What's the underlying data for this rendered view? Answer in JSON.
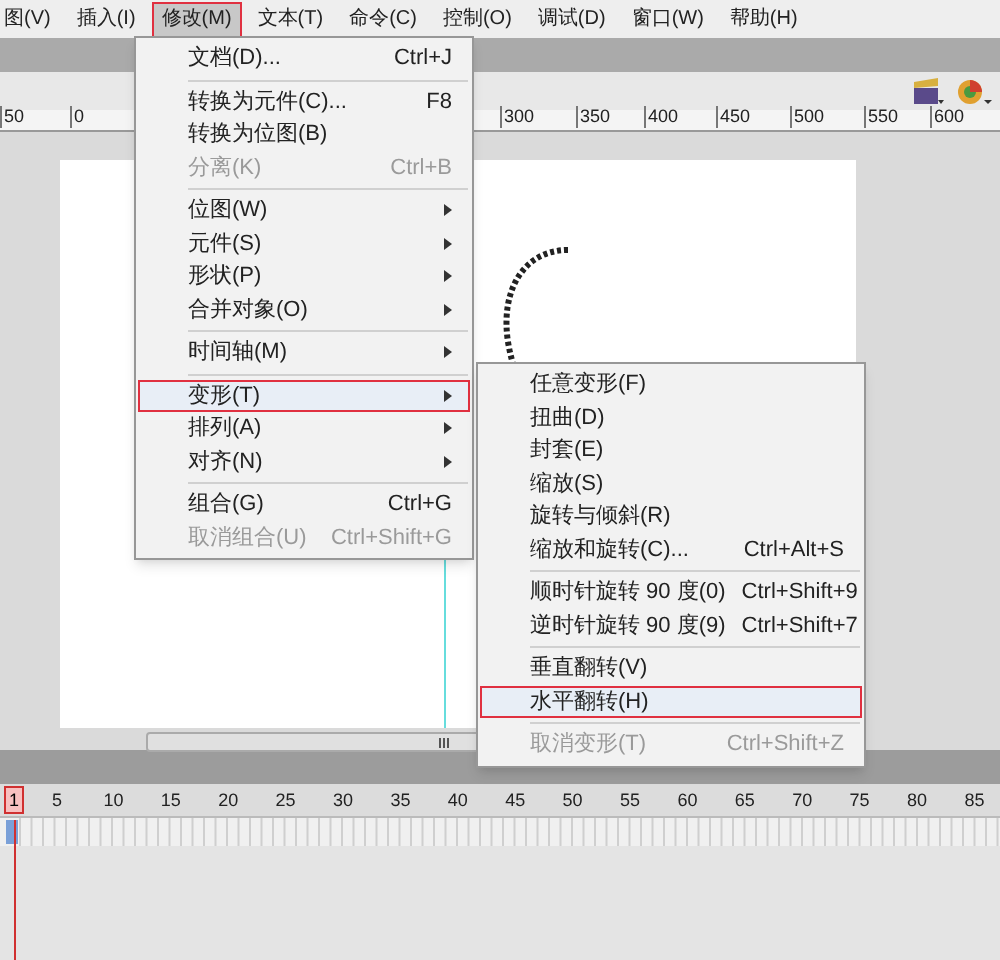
{
  "menu_bar": [
    {
      "label": "图(V)",
      "selected": false
    },
    {
      "label": "插入(I)",
      "selected": false
    },
    {
      "label": "修改(M)",
      "selected": true
    },
    {
      "label": "文本(T)",
      "selected": false
    },
    {
      "label": "命令(C)",
      "selected": false
    },
    {
      "label": "控制(O)",
      "selected": false
    },
    {
      "label": "调试(D)",
      "selected": false
    },
    {
      "label": "窗口(W)",
      "selected": false
    },
    {
      "label": "帮助(H)",
      "selected": false
    }
  ],
  "ruler": {
    "left_labels": [
      "50",
      "0"
    ],
    "right_labels": [
      "300",
      "350",
      "400",
      "450",
      "500",
      "550",
      "600"
    ]
  },
  "modify_menu": [
    {
      "kind": "item",
      "label": "文档(D)...",
      "shortcut": "Ctrl+J",
      "submenu": false,
      "disabled": false,
      "selected": false
    },
    {
      "kind": "separator"
    },
    {
      "kind": "item",
      "label": "转换为元件(C)...",
      "shortcut": "F8",
      "submenu": false,
      "disabled": false,
      "selected": false
    },
    {
      "kind": "item",
      "label": "转换为位图(B)",
      "submenu": false,
      "disabled": false,
      "selected": false
    },
    {
      "kind": "item",
      "label": "分离(K)",
      "shortcut": "Ctrl+B",
      "submenu": false,
      "disabled": true,
      "selected": false
    },
    {
      "kind": "separator"
    },
    {
      "kind": "item",
      "label": "位图(W)",
      "submenu": true,
      "disabled": false,
      "selected": false
    },
    {
      "kind": "item",
      "label": "元件(S)",
      "submenu": true,
      "disabled": false,
      "selected": false
    },
    {
      "kind": "item",
      "label": "形状(P)",
      "submenu": true,
      "disabled": false,
      "selected": false
    },
    {
      "kind": "item",
      "label": "合并对象(O)",
      "submenu": true,
      "disabled": false,
      "selected": false
    },
    {
      "kind": "separator"
    },
    {
      "kind": "item",
      "label": "时间轴(M)",
      "submenu": true,
      "disabled": false,
      "selected": false
    },
    {
      "kind": "separator"
    },
    {
      "kind": "item",
      "label": "变形(T)",
      "submenu": true,
      "disabled": false,
      "selected": true
    },
    {
      "kind": "item",
      "label": "排列(A)",
      "submenu": true,
      "disabled": false,
      "selected": false
    },
    {
      "kind": "item",
      "label": "对齐(N)",
      "submenu": true,
      "disabled": false,
      "selected": false
    },
    {
      "kind": "separator"
    },
    {
      "kind": "item",
      "label": "组合(G)",
      "shortcut": "Ctrl+G",
      "submenu": false,
      "disabled": false,
      "selected": false
    },
    {
      "kind": "item",
      "label": "取消组合(U)",
      "shortcut": "Ctrl+Shift+G",
      "submenu": false,
      "disabled": true,
      "selected": false
    }
  ],
  "transform_submenu": [
    {
      "kind": "item",
      "label": "任意变形(F)",
      "disabled": false,
      "selected": false
    },
    {
      "kind": "item",
      "label": "扭曲(D)",
      "disabled": false,
      "selected": false
    },
    {
      "kind": "item",
      "label": "封套(E)",
      "disabled": false,
      "selected": false
    },
    {
      "kind": "item",
      "label": "缩放(S)",
      "disabled": false,
      "selected": false
    },
    {
      "kind": "item",
      "label": "旋转与倾斜(R)",
      "disabled": false,
      "selected": false
    },
    {
      "kind": "item",
      "label": "缩放和旋转(C)...",
      "shortcut": "Ctrl+Alt+S",
      "disabled": false,
      "selected": false
    },
    {
      "kind": "separator"
    },
    {
      "kind": "item",
      "label": "顺时针旋转 90 度(0)",
      "shortcut": "Ctrl+Shift+9",
      "disabled": false,
      "selected": false
    },
    {
      "kind": "item",
      "label": "逆时针旋转 90 度(9)",
      "shortcut": "Ctrl+Shift+7",
      "disabled": false,
      "selected": false
    },
    {
      "kind": "separator"
    },
    {
      "kind": "item",
      "label": "垂直翻转(V)",
      "disabled": false,
      "selected": false
    },
    {
      "kind": "item",
      "label": "水平翻转(H)",
      "disabled": false,
      "selected": true
    },
    {
      "kind": "separator"
    },
    {
      "kind": "item",
      "label": "取消变形(T)",
      "shortcut": "Ctrl+Shift+Z",
      "disabled": true,
      "selected": false
    }
  ],
  "timeline": {
    "current_frame": "1",
    "frame_numbers": [
      "5",
      "10",
      "15",
      "20",
      "25",
      "30",
      "35",
      "40",
      "45",
      "50",
      "55",
      "60",
      "65",
      "70",
      "75",
      "80",
      "85"
    ]
  }
}
